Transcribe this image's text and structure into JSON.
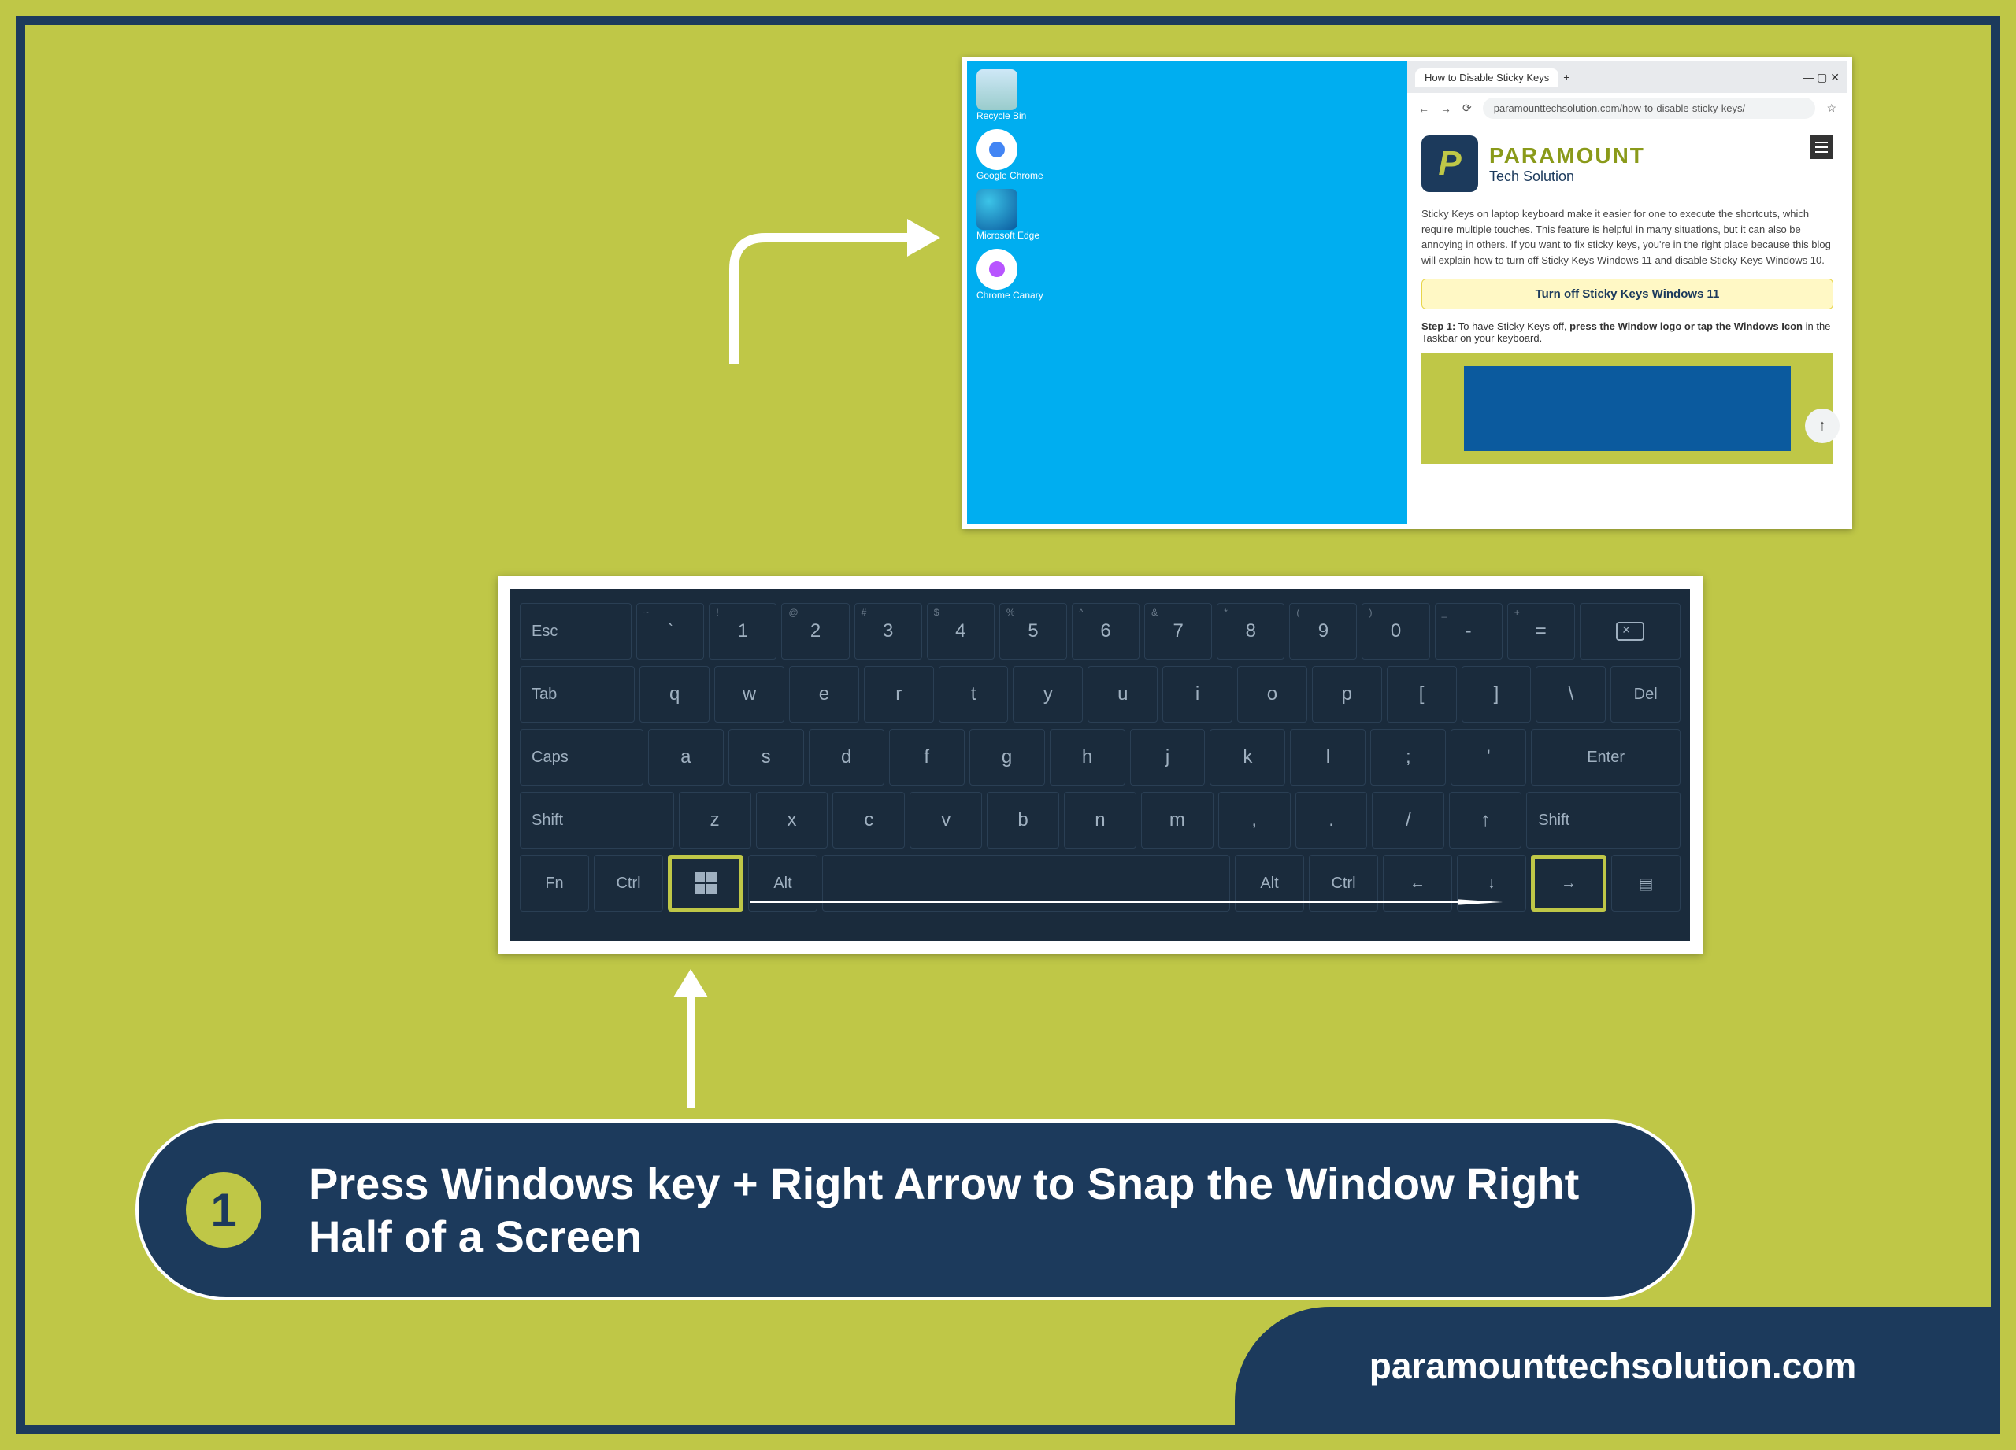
{
  "instruction": {
    "number": "1",
    "text": "Press Windows key + Right Arrow to Snap the Window Right Half of a Screen"
  },
  "footer_url": "paramounttechsolution.com",
  "split_screen": {
    "desktop": {
      "icons": [
        {
          "name": "recycle-bin",
          "label": "Recycle Bin"
        },
        {
          "name": "google-chrome",
          "label": "Google Chrome"
        },
        {
          "name": "microsoft-edge",
          "label": "Microsoft Edge"
        },
        {
          "name": "chrome-canary",
          "label": "Chrome Canary"
        }
      ]
    },
    "browser": {
      "tab_title": "How to Disable Sticky Keys",
      "nav": {
        "back": "←",
        "fwd": "→",
        "reload": "⟳"
      },
      "url": "paramounttechsolution.com/how-to-disable-sticky-keys/",
      "logo_line1": "PARAMOUNT",
      "logo_line2": "Tech Solution",
      "article_intro": "Sticky Keys on laptop keyboard make it easier for one to execute the shortcuts, which require multiple touches. This feature is helpful in many situations, but it can also be annoying in others. If you want to fix sticky keys, you're in the right place because this blog will explain how to turn off Sticky Keys Windows 11 and disable Sticky Keys Windows 10.",
      "callout": "Turn off Sticky Keys Windows 11",
      "step1_prefix": "Step 1:",
      "step1_mid": " To have Sticky Keys off, ",
      "step1_bold": "press the Window logo or tap the Windows Icon",
      "step1_suffix": " in the Taskbar on your keyboard."
    }
  },
  "keyboard": {
    "row0": [
      "Esc",
      "`",
      "1",
      "2",
      "3",
      "4",
      "5",
      "6",
      "7",
      "8",
      "9",
      "0",
      "-",
      "="
    ],
    "row0_sup": [
      "",
      "~",
      "!",
      "@",
      "#",
      "$",
      "%",
      "^",
      "&",
      "*",
      "(",
      ")",
      "_",
      "+"
    ],
    "row1": [
      "Tab",
      "q",
      "w",
      "e",
      "r",
      "t",
      "y",
      "u",
      "i",
      "o",
      "p",
      "[",
      "]",
      "\\",
      "Del"
    ],
    "row2": [
      "Caps",
      "a",
      "s",
      "d",
      "f",
      "g",
      "h",
      "j",
      "k",
      "l",
      ";",
      "'",
      "Enter"
    ],
    "row3": [
      "Shift",
      "z",
      "x",
      "c",
      "v",
      "b",
      "n",
      "m",
      ",",
      ".",
      "/",
      "↑",
      "Shift"
    ],
    "row4": [
      "Fn",
      "Ctrl",
      "⊞",
      "Alt",
      "",
      "Alt",
      "Ctrl",
      "←",
      "↓",
      "→",
      "▤"
    ]
  }
}
